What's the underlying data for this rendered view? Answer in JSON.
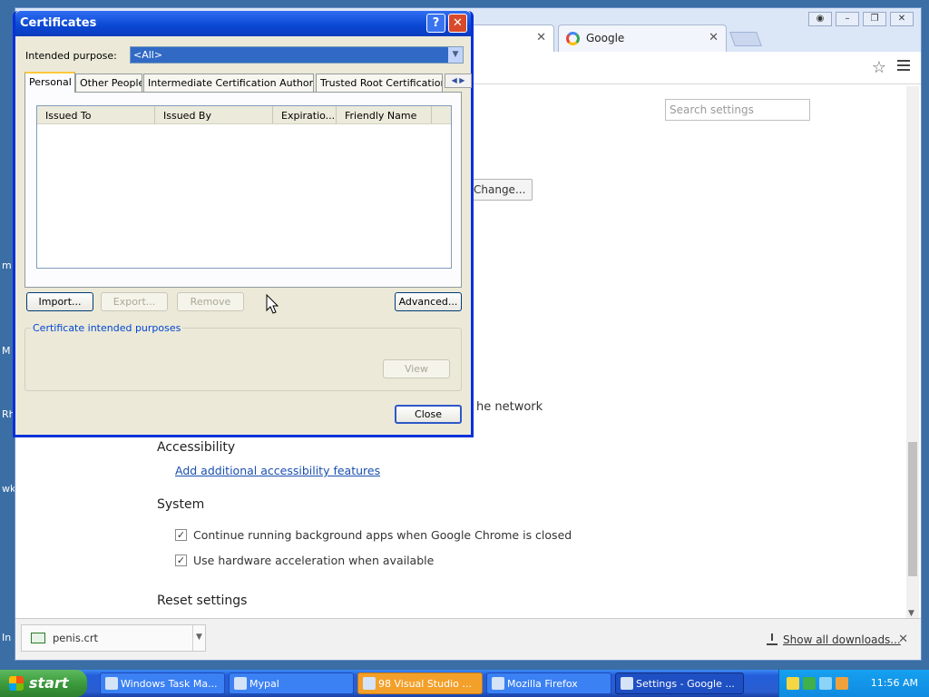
{
  "desktop": {
    "side_labels": [
      "m",
      "M",
      "Rh",
      "wk",
      "In"
    ]
  },
  "browser": {
    "tabs": [
      {
        "label": ""
      },
      {
        "label": "Google"
      }
    ],
    "settings": {
      "search_placeholder": "Search settings",
      "change_button": "Change...",
      "network_text": "he network",
      "accessibility_title": "Accessibility",
      "accessibility_link": "Add additional accessibility features",
      "system_title": "System",
      "system_options": [
        {
          "label": "Continue running background apps when Google Chrome is closed",
          "checked": true
        },
        {
          "label": "Use hardware acceleration when available",
          "checked": true
        }
      ],
      "reset_title": "Reset settings"
    },
    "download_bar": {
      "file_name": "penis.crt",
      "show_all": "Show all downloads..."
    }
  },
  "dialog": {
    "title": "Certificates",
    "intended_purpose_label": "Intended purpose:",
    "intended_purpose_value": "<All>",
    "tabs": [
      {
        "label": "Personal"
      },
      {
        "label": "Other People"
      },
      {
        "label": "Intermediate Certification Authorities"
      },
      {
        "label": "Trusted Root Certification"
      }
    ],
    "columns": [
      "Issued To",
      "Issued By",
      "Expiratio...",
      "Friendly Name"
    ],
    "buttons": {
      "import": "Import...",
      "export": "Export...",
      "remove": "Remove",
      "advanced": "Advanced...",
      "view": "View",
      "close": "Close"
    },
    "group_label": "Certificate intended purposes"
  },
  "taskbar": {
    "start_label": "start",
    "tasks": [
      {
        "label": "Windows Task Ma..."
      },
      {
        "label": "Mypal"
      },
      {
        "label": "98 Visual Studio ..."
      },
      {
        "label": "Mozilla Firefox"
      },
      {
        "label": "Settings - Google ..."
      }
    ],
    "clock": "11:56 AM"
  }
}
